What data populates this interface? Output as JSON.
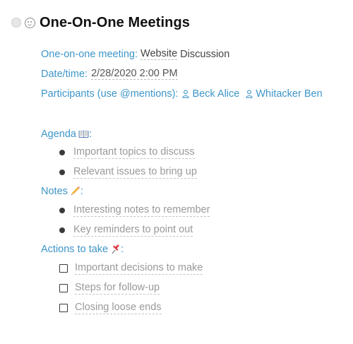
{
  "title_row": {
    "circle_icon": "circle-icon",
    "smiley_icon": "smiley-icon",
    "title": "One-On-One Meetings"
  },
  "fields": {
    "meeting": {
      "label": "One-on-one meeting:",
      "value_underlined": "Website",
      "value_rest": " Discussion"
    },
    "datetime": {
      "label": "Date/time:",
      "value": "2/28/2020 2:00 PM"
    },
    "participants": {
      "label": "Participants (use @mentions):",
      "people": [
        "Beck Alice",
        "Whitacker Ben"
      ]
    }
  },
  "agenda": {
    "header": "Agenda",
    "emoji": "book-icon",
    "suffix": ":",
    "items": [
      "Important topics to discuss",
      "Relevant issues to bring up"
    ]
  },
  "notes": {
    "header": "Notes",
    "emoji": "pencil-icon",
    "suffix": ":",
    "items": [
      "Interesting notes to remember",
      "Key reminders to point out"
    ]
  },
  "actions": {
    "header": "Actions to take",
    "emoji": "pushpin-icon",
    "suffix": ":",
    "items": [
      "Important decisions to make",
      "Steps for follow-up",
      "Closing loose ends"
    ]
  },
  "colors": {
    "accent": "#3d95c8",
    "placeholder": "#999999",
    "title": "#111111"
  }
}
